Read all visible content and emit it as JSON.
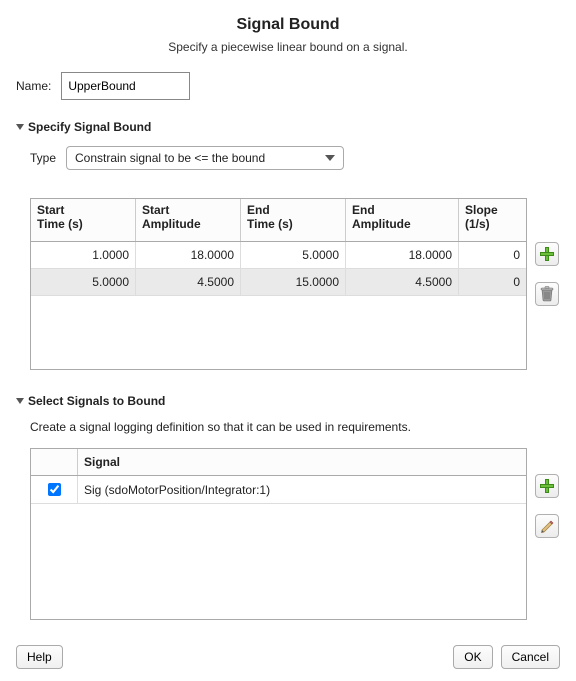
{
  "title": "Signal Bound",
  "subtitle": "Specify a piecewise linear bound on a signal.",
  "name_label": "Name:",
  "name_value": "UpperBound",
  "sections": {
    "bound_header": "Specify Signal Bound",
    "signals_header": "Select Signals to Bound"
  },
  "type_label": "Type",
  "type_value": "Constrain signal to be <= the bound",
  "bound_table": {
    "headers": {
      "start_time": "Start\nTime (s)",
      "start_amp": "Start\nAmplitude",
      "end_time": "End\nTime (s)",
      "end_amp": "End\nAmplitude",
      "slope": "Slope\n(1/s)"
    },
    "rows": [
      {
        "start_time": "1.0000",
        "start_amp": "18.0000",
        "end_time": "5.0000",
        "end_amp": "18.0000",
        "slope": "0",
        "selected": false
      },
      {
        "start_time": "5.0000",
        "start_amp": "4.5000",
        "end_time": "15.0000",
        "end_amp": "4.5000",
        "slope": "0",
        "selected": true
      }
    ]
  },
  "signals_desc": "Create a signal logging definition so that it can be used in requirements.",
  "signal_table": {
    "headers": {
      "checkbox": "",
      "signal": "Signal"
    },
    "rows": [
      {
        "checked": true,
        "signal": "Sig (sdoMotorPosition/Integrator:1)"
      }
    ]
  },
  "buttons": {
    "help": "Help",
    "ok": "OK",
    "cancel": "Cancel"
  },
  "icons": {
    "add": "plus-icon",
    "delete": "trash-icon",
    "edit": "pencil-icon",
    "dropdown": "chevron-down-icon",
    "collapse": "triangle-down-icon"
  }
}
